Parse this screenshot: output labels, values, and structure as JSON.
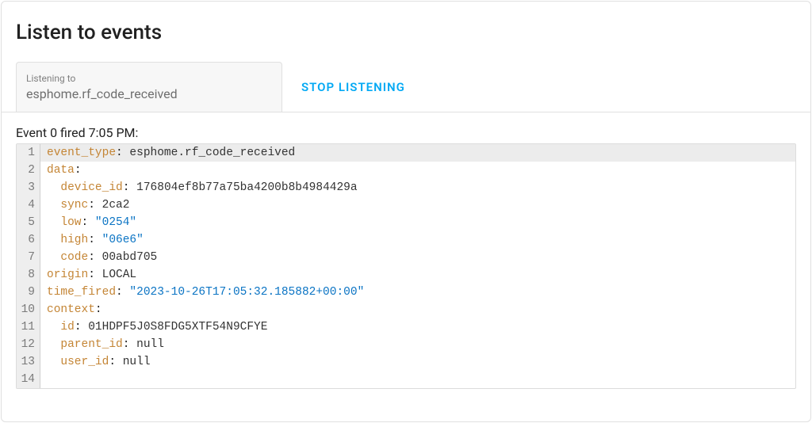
{
  "header": {
    "title": "Listen to events"
  },
  "controls": {
    "input_label": "Listening to",
    "input_value": "esphome.rf_code_received",
    "stop_label": "STOP LISTENING"
  },
  "event": {
    "header": "Event 0 fired 7:05 PM:",
    "line_numbers": [
      "1",
      "2",
      "3",
      "4",
      "5",
      "6",
      "7",
      "8",
      "9",
      "10",
      "11",
      "12",
      "13",
      "14"
    ],
    "yaml": {
      "event_type_key": "event_type",
      "event_type_val": "esphome.rf_code_received",
      "data_key": "data",
      "device_id_key": "device_id",
      "device_id_val": "176804ef8b77a75ba4200b8b4984429a",
      "sync_key": "sync",
      "sync_val": "2ca2",
      "low_key": "low",
      "low_val": "\"0254\"",
      "high_key": "high",
      "high_val": "\"06e6\"",
      "code_key": "code",
      "code_val": "00abd705",
      "origin_key": "origin",
      "origin_val": "LOCAL",
      "time_fired_key": "time_fired",
      "time_fired_val": "\"2023-10-26T17:05:32.185882+00:00\"",
      "context_key": "context",
      "id_key": "id",
      "id_val": "01HDPF5J0S8FDG5XTF54N9CFYE",
      "parent_id_key": "parent_id",
      "parent_id_val": "null",
      "user_id_key": "user_id",
      "user_id_val": "null"
    }
  }
}
